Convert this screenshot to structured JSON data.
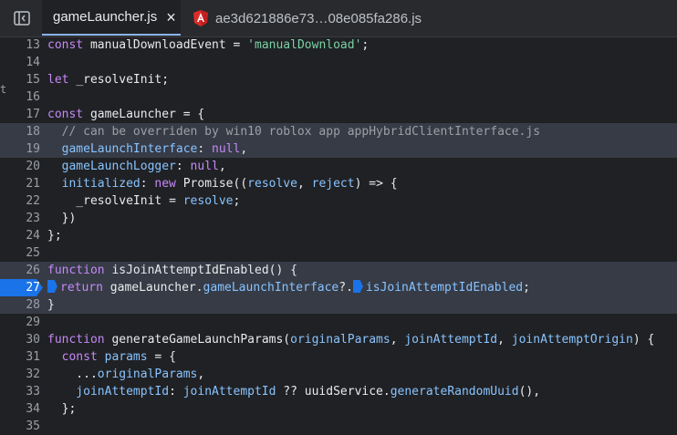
{
  "tabs": [
    {
      "label": "gameLauncher.js",
      "active": true,
      "close": "×"
    },
    {
      "label": "ae3d621886e73…08e085fa286.js",
      "active": false,
      "icon": "angular-icon"
    }
  ],
  "stray_char": "t",
  "editor": {
    "breakpoint_line": 27,
    "lines": [
      {
        "num": "13",
        "parts": [
          [
            "kw",
            "const "
          ],
          [
            "def",
            "manualDownloadEvent "
          ],
          [
            "def",
            "= "
          ],
          [
            "str",
            "'manualDownload'"
          ],
          [
            "def",
            ";"
          ]
        ]
      },
      {
        "num": "14",
        "parts": []
      },
      {
        "num": "15",
        "parts": [
          [
            "kw",
            "let "
          ],
          [
            "def",
            "_resolveInit;"
          ]
        ]
      },
      {
        "num": "16",
        "parts": []
      },
      {
        "num": "17",
        "parts": [
          [
            "kw",
            "const "
          ],
          [
            "def",
            "gameLauncher "
          ],
          [
            "def",
            "= {"
          ]
        ]
      },
      {
        "num": "18",
        "parts": [
          [
            "cmt",
            "  // can be overriden by win10 roblox app appHybridClientInterface.js"
          ]
        ],
        "hl": true
      },
      {
        "num": "19",
        "parts": [
          [
            "prop",
            "  gameLaunchInterface"
          ],
          [
            "def",
            ": "
          ],
          [
            "kw",
            "null"
          ],
          [
            "def",
            ","
          ]
        ],
        "hl": true
      },
      {
        "num": "20",
        "parts": [
          [
            "prop",
            "  gameLaunchLogger"
          ],
          [
            "def",
            ": "
          ],
          [
            "kw",
            "null"
          ],
          [
            "def",
            ","
          ]
        ]
      },
      {
        "num": "21",
        "parts": [
          [
            "prop",
            "  initialized"
          ],
          [
            "def",
            ": "
          ],
          [
            "kw",
            "new "
          ],
          [
            "def",
            "Promise(("
          ],
          [
            "param",
            "resolve"
          ],
          [
            "def",
            ", "
          ],
          [
            "param",
            "reject"
          ],
          [
            "def",
            ") => {"
          ]
        ]
      },
      {
        "num": "22",
        "parts": [
          [
            "def",
            "    _resolveInit "
          ],
          [
            "def",
            "= "
          ],
          [
            "param",
            "resolve"
          ],
          [
            "def",
            ";"
          ]
        ]
      },
      {
        "num": "23",
        "parts": [
          [
            "def",
            "  })"
          ]
        ]
      },
      {
        "num": "24",
        "parts": [
          [
            "def",
            "};"
          ]
        ]
      },
      {
        "num": "25",
        "parts": []
      },
      {
        "num": "26",
        "parts": [
          [
            "kw",
            "function "
          ],
          [
            "fn",
            "isJoinAttemptIdEnabled"
          ],
          [
            "def",
            "() {"
          ]
        ],
        "hl": true
      },
      {
        "num": "27",
        "parts": [
          [
            "bp",
            ""
          ],
          [
            "kw",
            "return "
          ],
          [
            "def",
            "gameLauncher."
          ],
          [
            "prop",
            "gameLaunchInterface"
          ],
          [
            "def",
            "?."
          ],
          [
            "bp",
            ""
          ],
          [
            "prop",
            "isJoinAttemptIdEnabled"
          ],
          [
            "def",
            ";"
          ]
        ],
        "hl": true,
        "breakpoint": true
      },
      {
        "num": "28",
        "parts": [
          [
            "def",
            "}"
          ]
        ],
        "hl": true
      },
      {
        "num": "29",
        "parts": []
      },
      {
        "num": "30",
        "parts": [
          [
            "kw",
            "function "
          ],
          [
            "fn",
            "generateGameLaunchParams"
          ],
          [
            "def",
            "("
          ],
          [
            "param",
            "originalParams"
          ],
          [
            "def",
            ", "
          ],
          [
            "param",
            "joinAttemptId"
          ],
          [
            "def",
            ", "
          ],
          [
            "param",
            "joinAttemptOrigin"
          ],
          [
            "def",
            ") {"
          ]
        ]
      },
      {
        "num": "31",
        "parts": [
          [
            "kw",
            "  const "
          ],
          [
            "param",
            "params "
          ],
          [
            "def",
            "= {"
          ]
        ]
      },
      {
        "num": "32",
        "parts": [
          [
            "def",
            "    ..."
          ],
          [
            "param",
            "originalParams"
          ],
          [
            "def",
            ","
          ]
        ]
      },
      {
        "num": "33",
        "parts": [
          [
            "prop",
            "    joinAttemptId"
          ],
          [
            "def",
            ": "
          ],
          [
            "param",
            "joinAttemptId "
          ],
          [
            "def",
            "?? "
          ],
          [
            "def",
            "uuidService."
          ],
          [
            "prop",
            "generateRandomUuid"
          ],
          [
            "def",
            "(),"
          ]
        ]
      },
      {
        "num": "34",
        "parts": [
          [
            "def",
            "  };"
          ]
        ]
      },
      {
        "num": "35",
        "parts": []
      }
    ]
  },
  "colors": {
    "breakpoint": "#1a73e8",
    "highlight": "#363b46",
    "keyword": "#c589f7",
    "string": "#7bd1a4"
  }
}
